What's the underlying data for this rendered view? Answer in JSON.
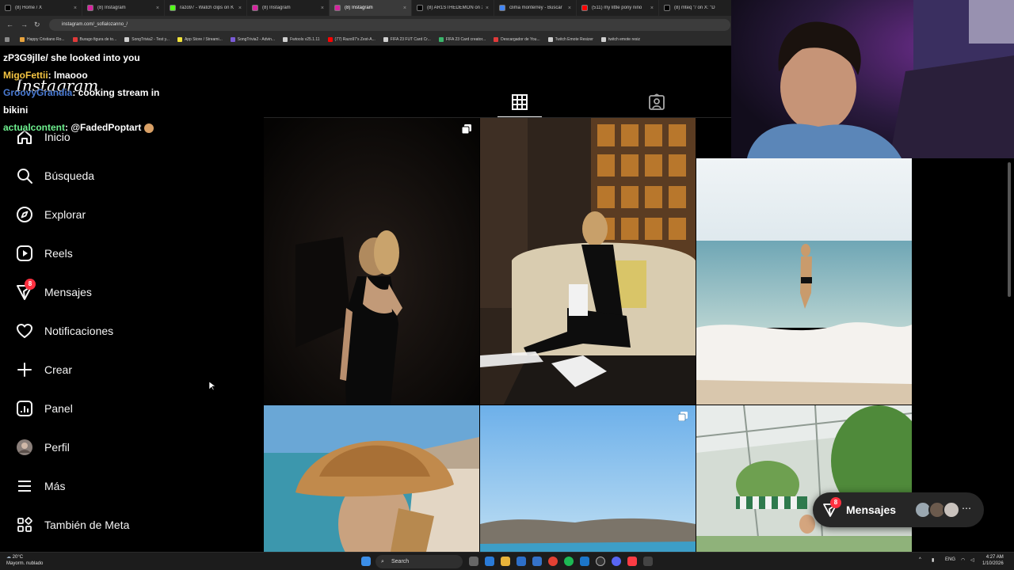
{
  "browser": {
    "tabs": [
      {
        "title": "(8) Home / X",
        "icon": "x-logo-icon",
        "color": "#000000",
        "active": false
      },
      {
        "title": "(8) Instagram",
        "icon": "instagram-icon",
        "color": "#d6249f",
        "active": false
      },
      {
        "title": "razo97 - Watch clips on K",
        "icon": "kick-icon",
        "color": "#53fc18",
        "active": false
      },
      {
        "title": "(8) Instagram",
        "icon": "instagram-icon",
        "color": "#d6249f",
        "active": false
      },
      {
        "title": "(8) Instagram",
        "icon": "instagram-icon",
        "color": "#d6249f",
        "active": true
      },
      {
        "title": "(8) AR1STHEDEMON on X",
        "icon": "x-logo-icon",
        "color": "#000000",
        "active": false
      },
      {
        "title": "clima monterrey - Buscar",
        "icon": "google-icon",
        "color": "#4285f4",
        "active": false
      },
      {
        "title": "(511) my little pony niño",
        "icon": "youtube-icon",
        "color": "#ff0000",
        "active": false
      },
      {
        "title": "(8) mteq \"/ on X: \"D",
        "icon": "x-logo-icon",
        "color": "#000000",
        "active": false
      }
    ],
    "url": "instagram.com/_sofialozanno_/",
    "bookmarks": [
      {
        "label": "Happy Cristiano Ro...",
        "color": "#e8a33d"
      },
      {
        "label": "Burago figura de to...",
        "color": "#e03a3a"
      },
      {
        "label": "SongTrivia2 - Test y...",
        "color": "#cfcfcf"
      },
      {
        "label": "App Store / Streami...",
        "color": "#f2e43a"
      },
      {
        "label": "SongTrivia2 - Advin...",
        "color": "#7a5bd6"
      },
      {
        "label": "Fwtools v25.1.11",
        "color": "#cfcfcf"
      },
      {
        "label": "(77) Razo97's Zest-A...",
        "color": "#ff0000"
      },
      {
        "label": "FIFA 23 FUT Card Cr...",
        "color": "#cfcfcf"
      },
      {
        "label": "FIFA 23 Card creator...",
        "color": "#3ab56b"
      },
      {
        "label": "Descargador de You...",
        "color": "#e03a3a"
      },
      {
        "label": "Twitch Emote Resizer",
        "color": "#cfcfcf"
      },
      {
        "label": "twitch emote resiz",
        "color": "#cfcfcf"
      }
    ]
  },
  "chat": {
    "messages": [
      {
        "user": "",
        "text": "zP3G9jlle/ she looked into you"
      },
      {
        "user": "MigoFettii",
        "text": ": lmaooo"
      },
      {
        "user": "GroovyGrandia",
        "text": ": cooking stream in bikini"
      },
      {
        "user": "actualcontent",
        "text": ": @FadedPoptart"
      }
    ]
  },
  "sidebar": {
    "logo": "Instagram",
    "items": [
      {
        "label": "Inicio",
        "icon": "home-icon"
      },
      {
        "label": "Búsqueda",
        "icon": "search-icon"
      },
      {
        "label": "Explorar",
        "icon": "compass-icon"
      },
      {
        "label": "Reels",
        "icon": "reels-icon"
      },
      {
        "label": "Mensajes",
        "icon": "messenger-icon",
        "badge": "8"
      },
      {
        "label": "Notificaciones",
        "icon": "heart-icon"
      },
      {
        "label": "Crear",
        "icon": "plus-icon"
      },
      {
        "label": "Panel",
        "icon": "dashboard-icon"
      },
      {
        "label": "Perfil",
        "icon": "avatar-icon"
      },
      {
        "label": "Más",
        "icon": "menu-icon"
      },
      {
        "label": "También de Meta",
        "icon": "meta-apps-icon"
      }
    ]
  },
  "profile_tabs": [
    {
      "name": "posts",
      "icon": "grid-icon",
      "active": true
    },
    {
      "name": "tagged",
      "icon": "tagged-icon",
      "active": false
    }
  ],
  "posts": [
    {
      "alt": "Woman in black backless dress against dark background",
      "multi": true
    },
    {
      "alt": "Woman in black outfit sitting on ornate sofa",
      "multi": false
    },
    {
      "alt": "Woman in bikini walking into the sea",
      "multi": false
    },
    {
      "alt": "Woman wearing straw cowboy hat at the beach",
      "multi": false
    },
    {
      "alt": "Blue sky over desert mountains and sea",
      "multi": true
    },
    {
      "alt": "Striped awning in a greenhouse garden",
      "multi": false
    }
  ],
  "messages_pill": {
    "label": "Mensajes",
    "badge": "8"
  },
  "taskbar": {
    "temperature": "20°C",
    "condition": "Mayorm. nublado",
    "search_placeholder": "Search",
    "language": "ENG",
    "time": "4:27 AM",
    "date": "1/10/2026"
  }
}
